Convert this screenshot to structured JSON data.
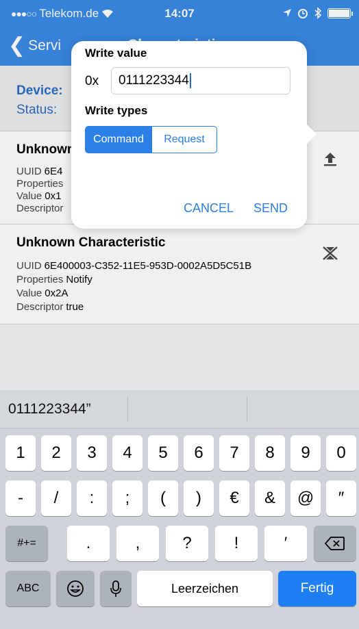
{
  "status_bar": {
    "carrier": "Telekom.de",
    "time": "14:07"
  },
  "nav": {
    "back_label": "Servi",
    "title": "Characteristics"
  },
  "device_section": {
    "device_label": "Device:",
    "status_label": "Status:"
  },
  "characteristics": [
    {
      "name": "Unknown Characteristic",
      "uuid_label": "UUID",
      "uuid": "6E4",
      "properties_label": "Properties",
      "value_label": "Value",
      "value": "0x1",
      "descriptor_label": "Descriptor",
      "icon": "upload-icon"
    },
    {
      "name": "Unknown Characteristic",
      "uuid_label": "UUID",
      "uuid": "6E400003-C352-11E5-953D-0002A5D5C51B",
      "properties_label": "Properties",
      "properties": "Notify",
      "value_label": "Value",
      "value": "0x2A",
      "descriptor_label": "Descriptor",
      "descriptor": "true",
      "icon": "notify-icon"
    }
  ],
  "dialog": {
    "title": "Write value",
    "prefix": "0x",
    "input_value": "0111223344",
    "types_title": "Write types",
    "type_command": "Command",
    "type_request": "Request",
    "selected_type": "Command",
    "cancel": "CANCEL",
    "send": "SEND"
  },
  "keyboard": {
    "suggestion": "0111223344”",
    "row1": [
      "1",
      "2",
      "3",
      "4",
      "5",
      "6",
      "7",
      "8",
      "9",
      "0"
    ],
    "row2": [
      "-",
      "/",
      ":",
      ";",
      "(",
      ")",
      "€",
      "&",
      "@",
      "″"
    ],
    "row3": [
      ".",
      ",",
      "?",
      "!",
      "′"
    ],
    "symbols_key": "#+=",
    "abc_key": "ABC",
    "space_key": "Leerzeichen",
    "done_key": "Fertig"
  },
  "colors": {
    "nav_bg": "#3a8be6",
    "accent": "#2b7fe6",
    "done_key": "#1e7ff2"
  }
}
